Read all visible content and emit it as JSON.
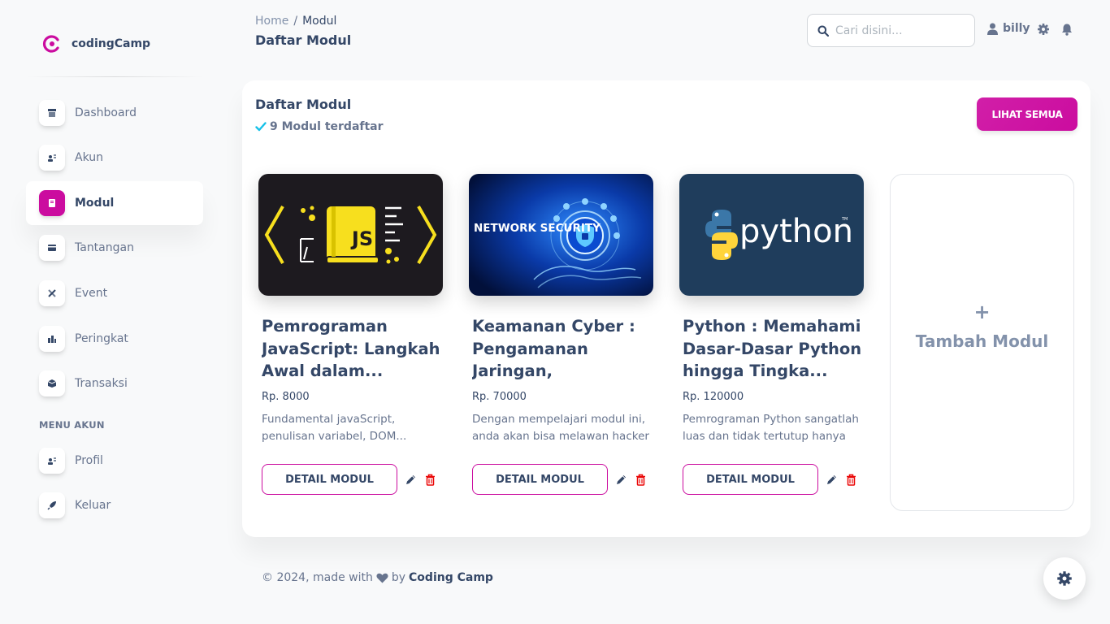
{
  "brand": {
    "name": "codingCamp"
  },
  "sidebar": {
    "items": [
      {
        "label": "Dashboard",
        "icon": "shop-icon"
      },
      {
        "label": "Akun",
        "icon": "user-card-icon"
      },
      {
        "label": "Modul",
        "icon": "book-icon",
        "active": true
      },
      {
        "label": "Tantangan",
        "icon": "credit-card-icon"
      },
      {
        "label": "Event",
        "icon": "tools-icon"
      },
      {
        "label": "Peringkat",
        "icon": "chart-building-icon"
      },
      {
        "label": "Transaksi",
        "icon": "box-icon"
      }
    ],
    "section_label": "MENU AKUN",
    "account_items": [
      {
        "label": "Profil",
        "icon": "user-card-icon"
      },
      {
        "label": "Keluar",
        "icon": "rocket-icon"
      }
    ]
  },
  "header": {
    "breadcrumb_home": "Home",
    "breadcrumb_sep": "/",
    "breadcrumb_current": "Modul",
    "title": "Daftar Modul",
    "search_placeholder": "Cari disini...",
    "username": "billy"
  },
  "card": {
    "title": "Daftar Modul",
    "count_text": "9 Modul terdaftar",
    "see_all_label": "LIHAT SEMUA"
  },
  "modules": [
    {
      "title": "Pemrograman JavaScript: Langkah Awal dalam...",
      "price": "Rp. 8000",
      "desc": "Fundamental javaScript, penulisan variabel, DOM...",
      "image_text": "JS"
    },
    {
      "title": "Keamanan Cyber : Pengamanan Jaringan, Perlindungan...",
      "price": "Rp. 70000",
      "desc": "Dengan mempelajari modul ini, anda akan bisa melawan hacker",
      "image_text": "NETWORK SECURITY"
    },
    {
      "title": "Python : Memahami Dasar-Dasar Python hingga Tingka...",
      "price": "Rp. 120000",
      "desc": "Pemrograman Python sangatlah luas dan tidak tertutup hanya p...",
      "image_text": "python"
    }
  ],
  "detail_label": "DETAIL MODUL",
  "add_module": {
    "plus": "+",
    "label": "Tambah Modul"
  },
  "footer": {
    "prefix": "© 2024, made with",
    "by": "by",
    "link": "Coding Camp"
  },
  "colors": {
    "accent": "#cb0c9f",
    "text": "#344767",
    "muted": "#67748e",
    "danger": "#ea0606",
    "check": "#17c1e8"
  }
}
